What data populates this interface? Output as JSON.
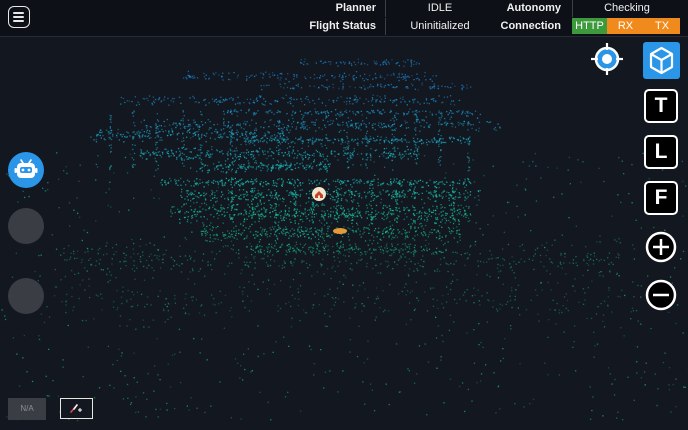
{
  "status": {
    "planner_label": "Planner",
    "planner_value": "IDLE",
    "autonomy_label": "Autonomy",
    "autonomy_value": "Checking",
    "flight_label": "Flight Status",
    "flight_value": "Uninitialized",
    "connection_label": "Connection",
    "connection_items": [
      {
        "label": "HTTP",
        "color": "#3c9a3c"
      },
      {
        "label": "RX",
        "color": "#f08a1c"
      },
      {
        "label": "TX",
        "color": "#f08a1c"
      }
    ]
  },
  "left_panel": {
    "na_label": "N/A"
  },
  "view_controls": {
    "top_label": "T",
    "left_label": "L",
    "front_label": "F"
  },
  "icons": {
    "menu": "hamburger-menu-icon",
    "robot": "robot-face-icon",
    "tool": "wand-icon",
    "target": "crosshair-target-icon",
    "cube": "3d-cube-icon",
    "zoom_in": "plus-circle-icon",
    "zoom_out": "minus-circle-icon",
    "home": "home-marker-icon"
  },
  "colors": {
    "background": "#131820",
    "accent_blue": "#2b95e8",
    "cloud_blue": "#1e90e6",
    "cloud_teal": "#19c79c"
  }
}
